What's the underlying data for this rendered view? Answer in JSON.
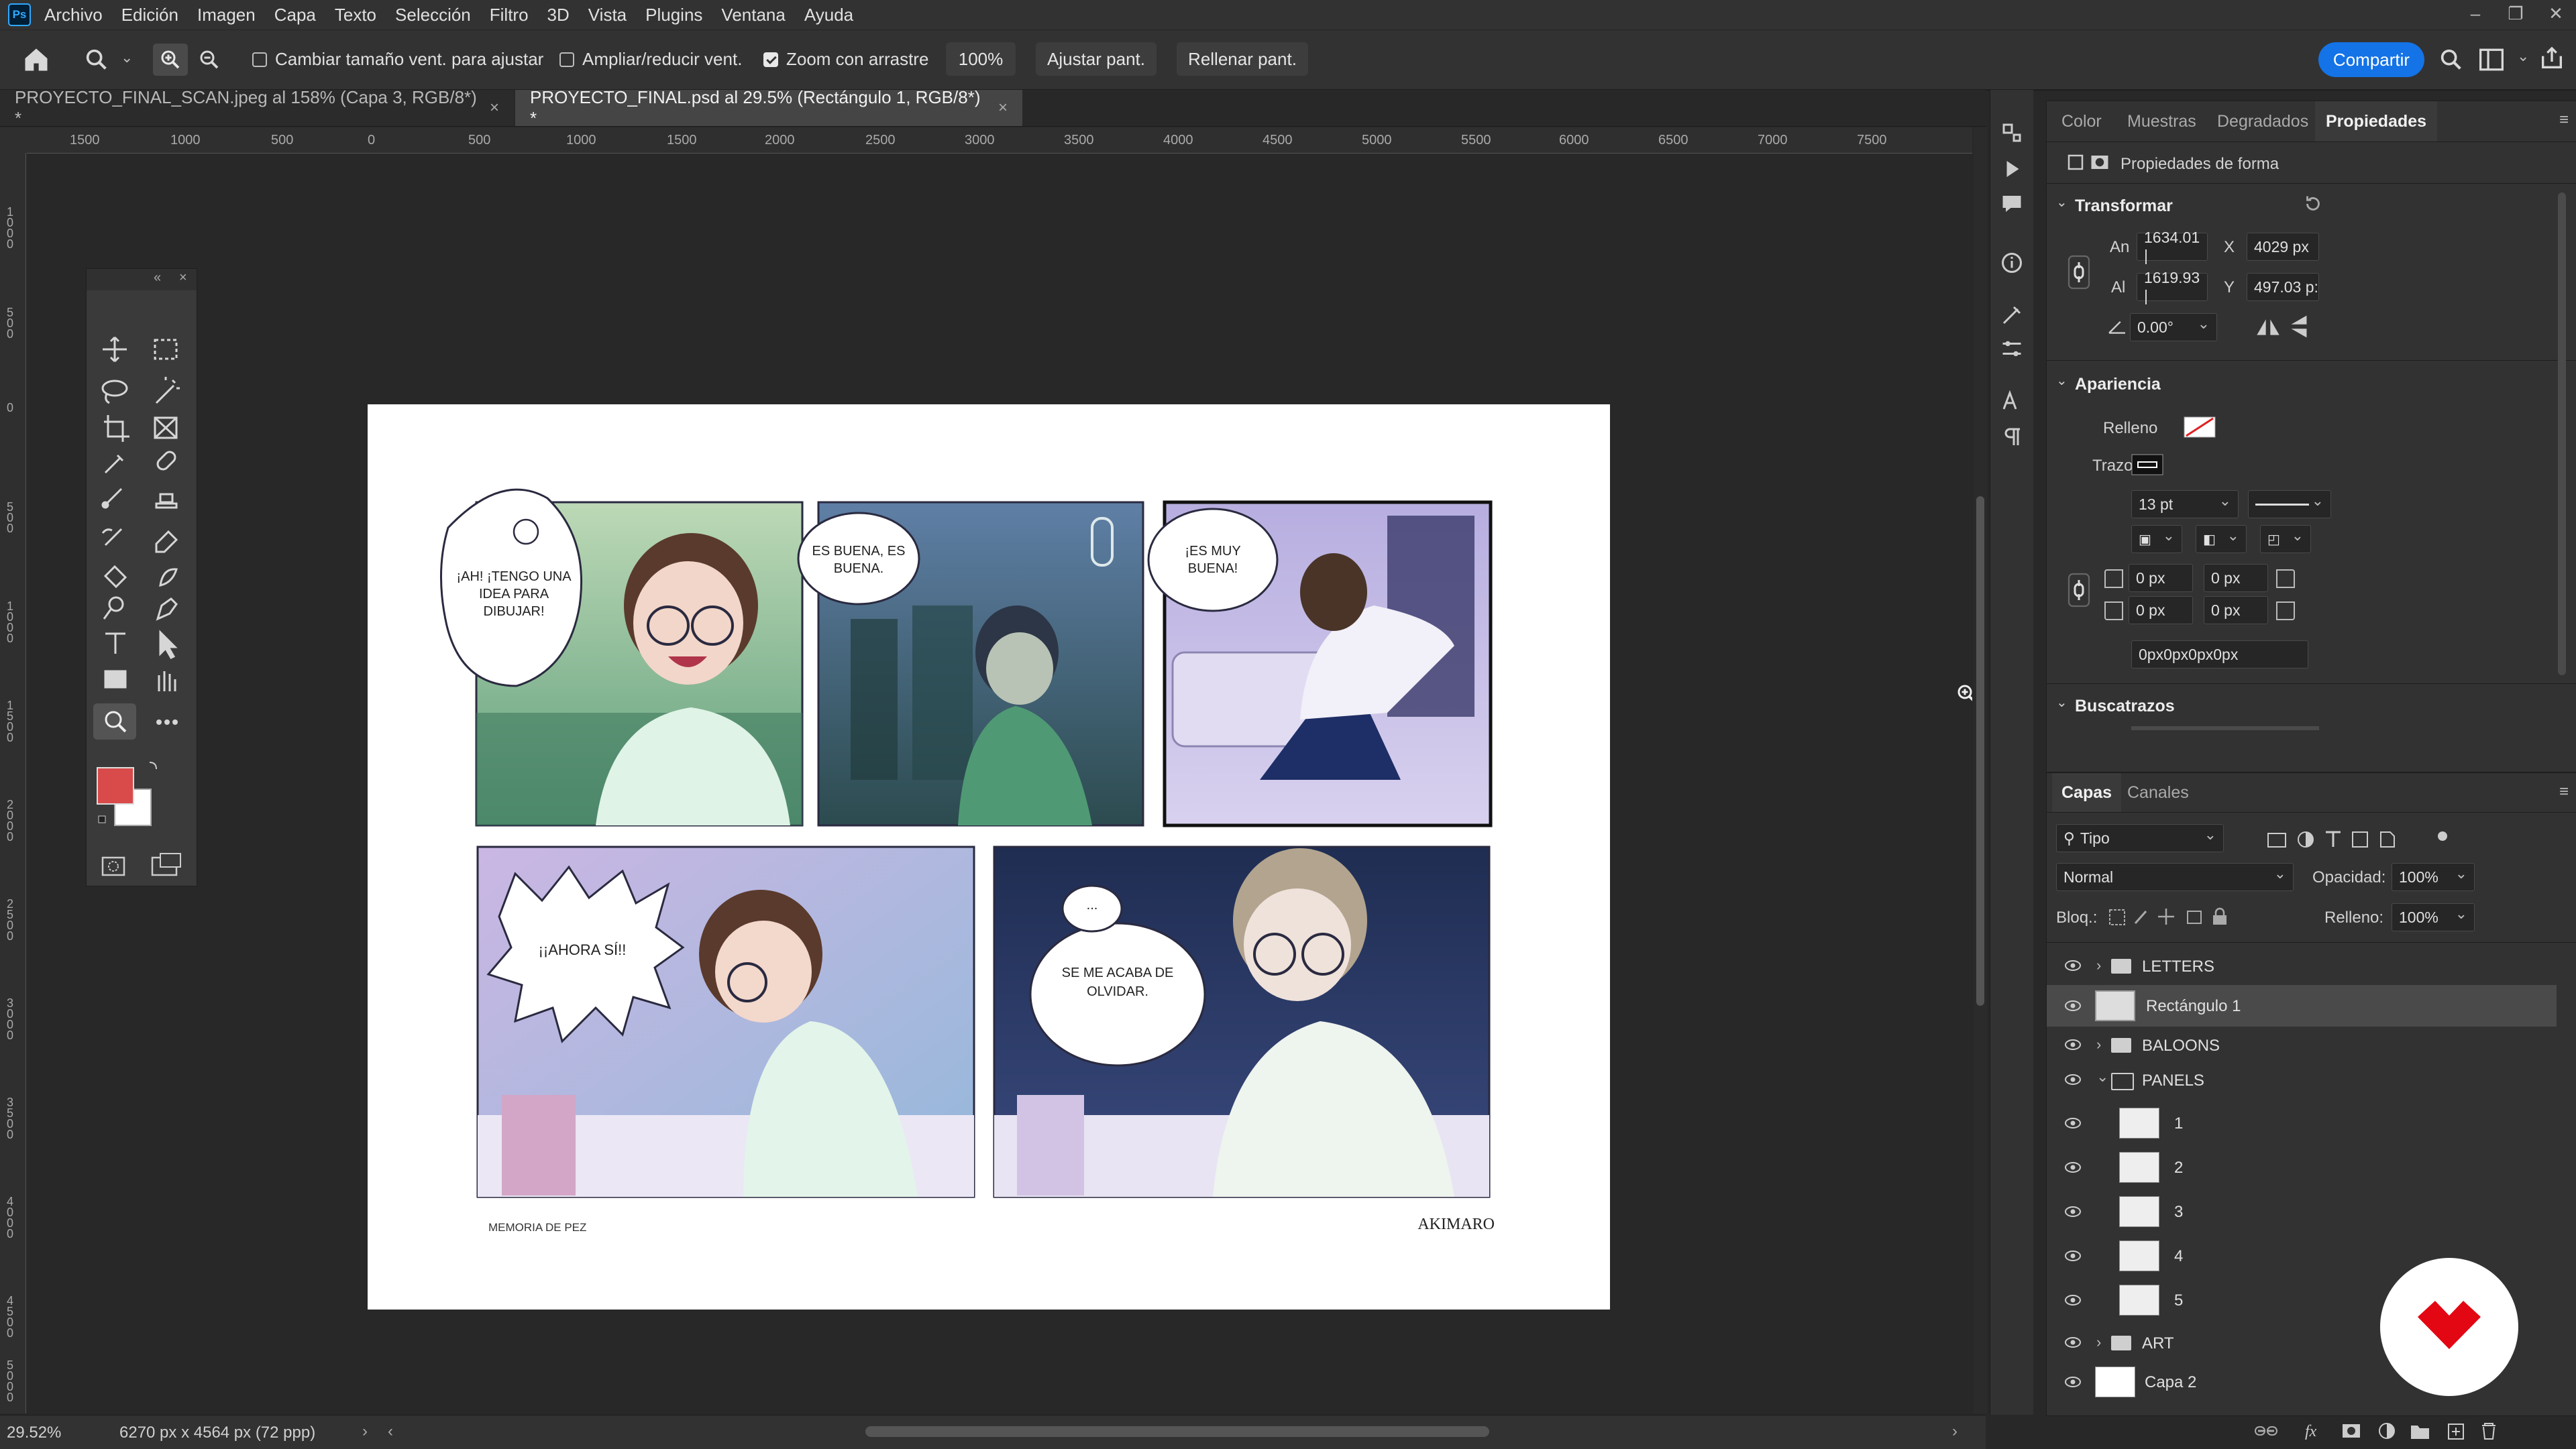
{
  "menubar": {
    "items": [
      "Archivo",
      "Edición",
      "Imagen",
      "Capa",
      "Texto",
      "Selección",
      "Filtro",
      "3D",
      "Vista",
      "Plugins",
      "Ventana",
      "Ayuda"
    ]
  },
  "options": {
    "resize_window_label": "Cambiar tamaño vent. para ajustar",
    "zoom_all_label": "Ampliar/reducir vent.",
    "scrubby_label": "Zoom con arrastre",
    "zoom_value": "100%",
    "fit_label": "Ajustar pant.",
    "fill_label": "Rellenar pant.",
    "share_label": "Compartir"
  },
  "tabs": [
    {
      "label": "PROYECTO_FINAL_SCAN.jpeg al 158% (Capa 3, RGB/8*) *"
    },
    {
      "label": "PROYECTO_FINAL.psd al 29.5% (Rectángulo 1, RGB/8*) *"
    }
  ],
  "ruler": {
    "h_ticks": [
      "1500",
      "1000",
      "500",
      "0",
      "500",
      "1000",
      "1500",
      "2000",
      "2500",
      "3000",
      "3500",
      "4000",
      "4500",
      "5000",
      "5500",
      "6000",
      "6500",
      "7000",
      "7500"
    ],
    "v_ticks": [
      "1000",
      "500",
      "0",
      "500",
      "1000",
      "1500",
      "2000",
      "2500",
      "3000",
      "3500",
      "4000",
      "4500",
      "5000"
    ]
  },
  "comic": {
    "p1_text": "¡AH! ¡TENGO UNA IDEA PARA DIBUJAR!",
    "p2_text": "ES BUENA, ES BUENA.",
    "p3_text": "¡ES MUY BUENA!",
    "p4_text": "¡¡AHORA SÍ!!",
    "p5_dots": "...",
    "p5_text": "SE ME ACABA DE OLVIDAR.",
    "footer_left": "MEMORIA DE PEZ",
    "footer_right": "AKIMARO"
  },
  "status": {
    "zoom": "29.52%",
    "doc_info": "6270 px x 4564 px (72 ppp)"
  },
  "properties": {
    "tabs": [
      "Color",
      "Muestras",
      "Degradados",
      "Propiedades"
    ],
    "shape_props_label": "Propiedades de forma",
    "transform_head": "Transformar",
    "w_label": "An",
    "w_value": "1634.01 |",
    "x_label": "X",
    "x_value": "4029 px",
    "h_label": "Al",
    "h_value": "1619.93 |",
    "y_label": "Y",
    "y_value": "497.03 p:",
    "angle_value": "0.00°",
    "appearance_head": "Apariencia",
    "fill_label": "Relleno",
    "stroke_label": "Trazo",
    "stroke_size": "13 pt",
    "corner_tl": "0 px",
    "corner_tr": "0 px",
    "corner_bl": "0 px",
    "corner_br": "0 px",
    "corners_combined": "0px0px0px0px",
    "pathfinder_head": "Buscatrazos"
  },
  "layers": {
    "tabs": [
      "Capas",
      "Canales"
    ],
    "filter_label": "Tipo",
    "blend_mode": "Normal",
    "opacity_label": "Opacidad:",
    "opacity_value": "100%",
    "lock_label": "Bloq.:",
    "fill_label": "Relleno:",
    "fill_value": "100%",
    "items": [
      {
        "name": "LETTERS",
        "kind": "group"
      },
      {
        "name": "Rectángulo 1",
        "kind": "shape"
      },
      {
        "name": "BALOONS",
        "kind": "group"
      },
      {
        "name": "PANELS",
        "kind": "group-open"
      },
      {
        "name": "1",
        "kind": "child"
      },
      {
        "name": "2",
        "kind": "child"
      },
      {
        "name": "3",
        "kind": "child"
      },
      {
        "name": "4",
        "kind": "child"
      },
      {
        "name": "5",
        "kind": "child"
      },
      {
        "name": "ART",
        "kind": "group"
      },
      {
        "name": "Capa 2",
        "kind": "layer"
      }
    ]
  },
  "colors": {
    "foreground": "#d94a4a",
    "background": "#ffffff",
    "accent": "#1473e6",
    "logo_red": "#e30613"
  }
}
